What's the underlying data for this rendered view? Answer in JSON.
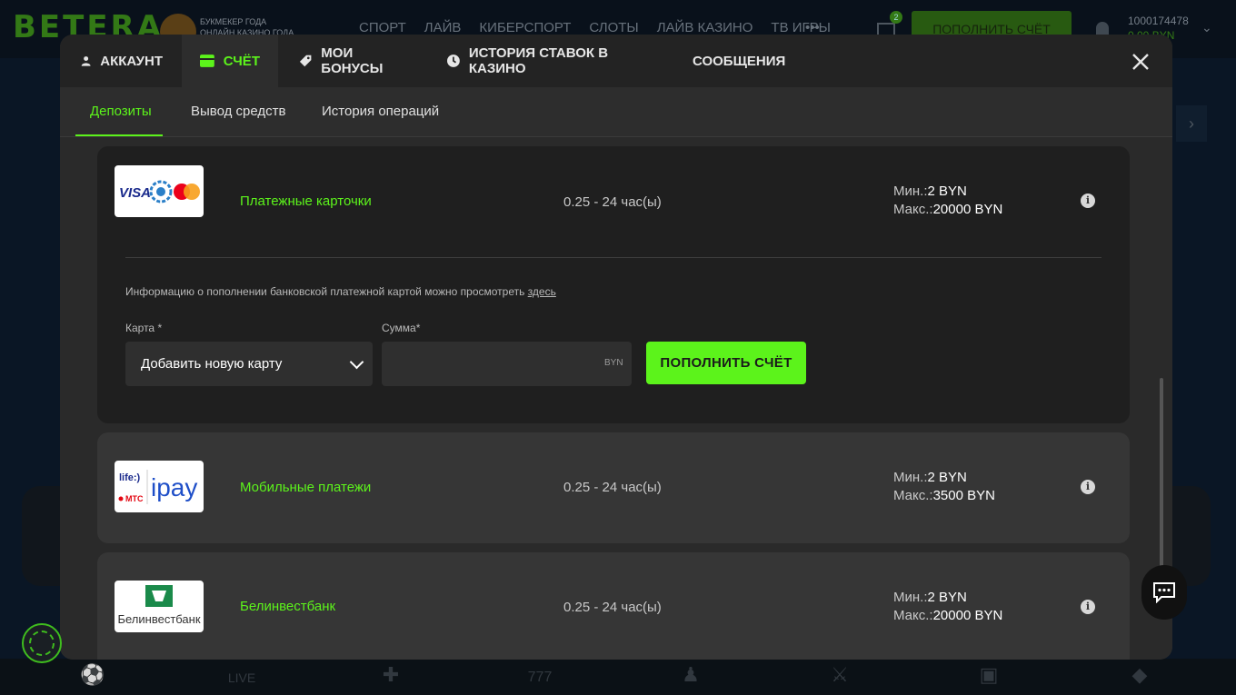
{
  "site": {
    "logo": "BETERA",
    "promo_line1": "БУКМЕКЕР ГОДА",
    "promo_line2": "ОНЛАЙН КАЗИНО ГОДА",
    "nav": [
      "СПОРТ",
      "ЛАЙВ",
      "КИБЕРСПОРТ",
      "СЛОТЫ",
      "ЛАЙВ КАЗИНО",
      "ТВ ИГРЫ"
    ],
    "more": "•••",
    "mail_badge": "2",
    "deposit_label": "ПОПОЛНИТЬ СЧЁТ",
    "user_id": "1000174478",
    "user_balance": "0.00 BYN",
    "bottom_live_label": "LIVE"
  },
  "modal": {
    "tabs": [
      {
        "label": "АККАУНТ",
        "icon": "user-icon"
      },
      {
        "label": "СЧЁТ",
        "icon": "wallet-icon",
        "active": true
      },
      {
        "label": "МОИ БОНУСЫ",
        "icon": "tag-icon"
      },
      {
        "label": "ИСТОРИЯ СТАВОК В КАЗИНО",
        "icon": "clock-icon"
      },
      {
        "label": "СООБЩЕНИЯ",
        "icon": "mail-icon"
      }
    ],
    "close_icon": "close-icon",
    "subtabs": [
      {
        "label": "Депозиты",
        "active": true
      },
      {
        "label": "Вывод средств"
      },
      {
        "label": "История операций"
      }
    ]
  },
  "methods": [
    {
      "name": "Платежные карточки",
      "time": "0.25 - 24 час(ы)",
      "min_label": "Мин.:",
      "min_value": "2 BYN",
      "max_label": "Макс.:",
      "max_value": "20000 BYN",
      "logo_text": "VISA"
    },
    {
      "name": "Мобильные платежи",
      "time": "0.25 - 24 час(ы)",
      "min_label": "Мин.:",
      "min_value": "2 BYN",
      "max_label": "Макс.:",
      "max_value": "3500 BYN",
      "logo_text_top": "life:)",
      "logo_text_mid": "МТС",
      "logo_text": "ipay"
    },
    {
      "name": "Белинвестбанк",
      "time": "0.25 - 24 час(ы)",
      "min_label": "Мин.:",
      "min_value": "2 BYN",
      "max_label": "Макс.:",
      "max_value": "20000 BYN",
      "logo_text": "Белинвестбанк"
    }
  ],
  "deposit_form": {
    "info_text": "Информацию о пополнении банковской платежной картой можно просмотреть ",
    "info_link": "здесь",
    "card_label": "Карта *",
    "card_value": "Добавить новую карту",
    "amount_label": "Сумма*",
    "amount_value": "",
    "amount_unit": "BYN",
    "submit_label": "ПОПОЛНИТЬ СЧЁТ"
  },
  "colors": {
    "accent": "#5cf31b",
    "modal_bg": "#2d2d2d",
    "tab_bar_bg": "#232323",
    "card_bg": "#363636",
    "expanded_bg": "#1f1f1f"
  }
}
